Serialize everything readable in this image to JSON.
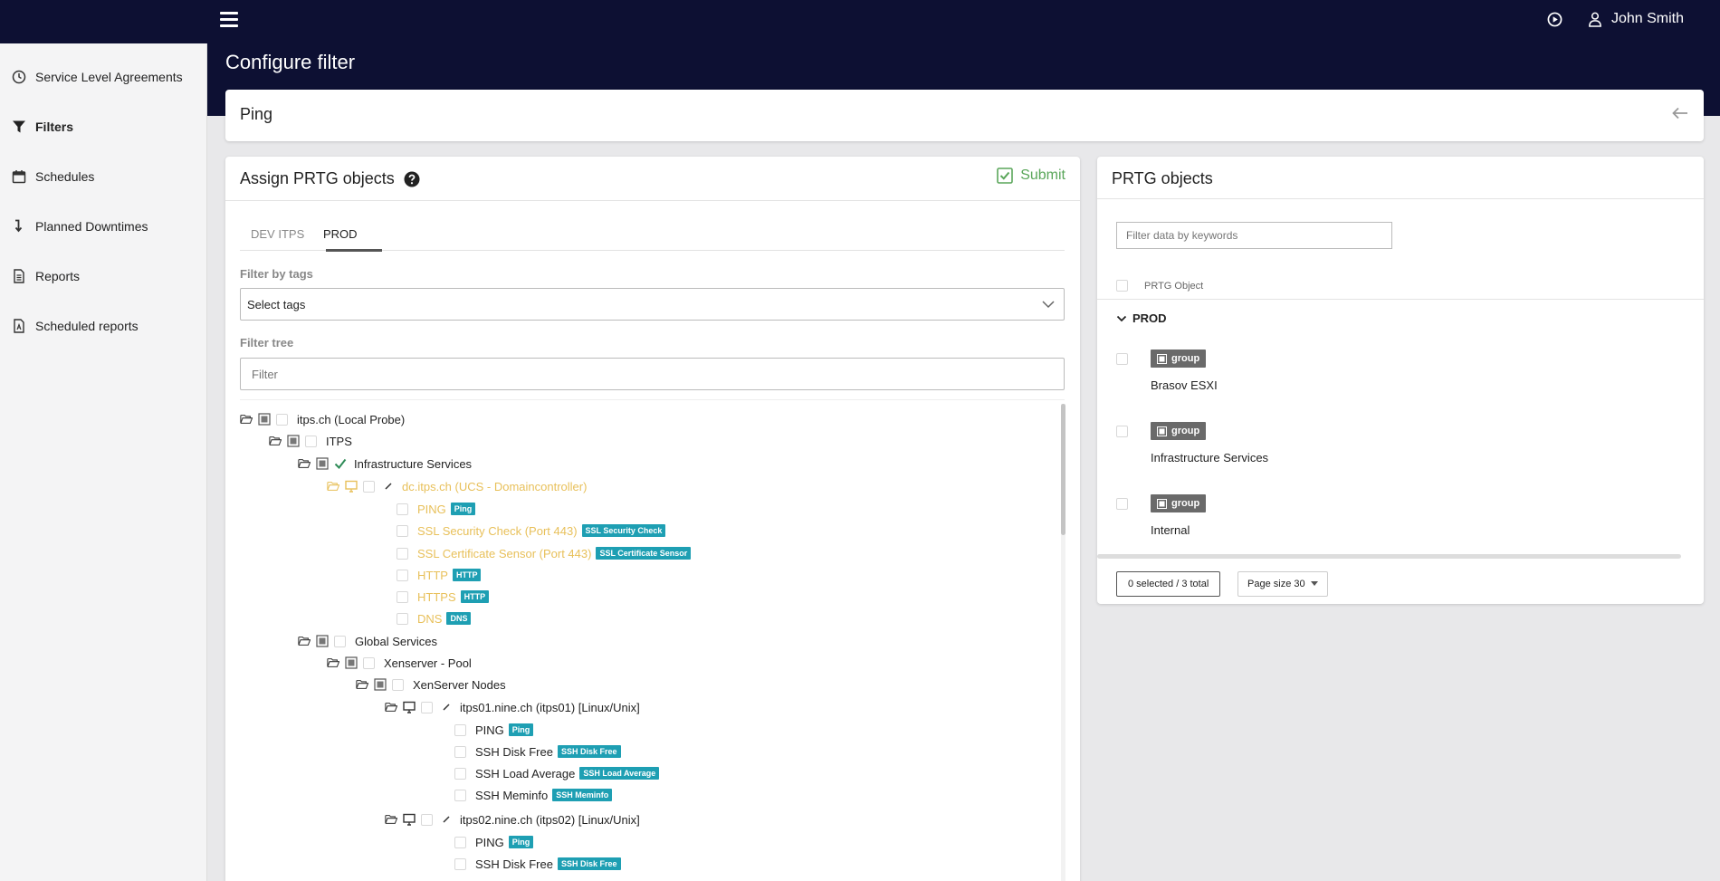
{
  "header": {
    "page_title": "Configure filter",
    "user_name": "John Smith"
  },
  "sidebar": {
    "items": [
      {
        "label": "Service Level Agreements",
        "icon": "clock-icon"
      },
      {
        "label": "Filters",
        "icon": "filter-icon",
        "active": true
      },
      {
        "label": "Schedules",
        "icon": "calendar-icon"
      },
      {
        "label": "Planned Downtimes",
        "icon": "arrow-down-icon"
      },
      {
        "label": "Reports",
        "icon": "document-icon"
      },
      {
        "label": "Scheduled reports",
        "icon": "pdf-document-icon"
      }
    ]
  },
  "filter_card": {
    "title": "Ping"
  },
  "assign": {
    "title": "Assign PRTG objects",
    "submit_label": "Submit",
    "tabs": [
      {
        "label": "DEV ITPS"
      },
      {
        "label": "PROD",
        "active": true
      }
    ],
    "filter_by_tags_label": "Filter by tags",
    "select_tags_placeholder": "Select tags",
    "filter_tree_label": "Filter tree",
    "filter_tree_placeholder": "Filter",
    "tree": [
      {
        "label": "itps.ch (Local Probe)",
        "type": "probe"
      },
      {
        "label": "ITPS",
        "type": "group"
      },
      {
        "label": "Infrastructure Services",
        "type": "group",
        "checked": true
      },
      {
        "label": "dc.itps.ch (UCS - Domaincontroller)",
        "type": "device"
      },
      {
        "label": "PING",
        "tag": "Ping"
      },
      {
        "label": "SSL Security Check (Port 443)",
        "tag": "SSL Security Check"
      },
      {
        "label": "SSL Certificate Sensor (Port 443)",
        "tag": "SSL Certificate Sensor"
      },
      {
        "label": "HTTP",
        "tag": "HTTP"
      },
      {
        "label": "HTTPS",
        "tag": "HTTP"
      },
      {
        "label": "DNS",
        "tag": "DNS"
      },
      {
        "label": "Global Services",
        "type": "group"
      },
      {
        "label": "Xenserver - Pool",
        "type": "group"
      },
      {
        "label": "XenServer Nodes",
        "type": "group"
      },
      {
        "label": "itps01.nine.ch (itps01) [Linux/Unix]",
        "type": "device"
      },
      {
        "label": "PING",
        "tag": "Ping"
      },
      {
        "label": "SSH Disk Free",
        "tag": "SSH Disk Free"
      },
      {
        "label": "SSH Load Average",
        "tag": "SSH Load Average"
      },
      {
        "label": "SSH Meminfo",
        "tag": "SSH Meminfo"
      },
      {
        "label": "itps02.nine.ch (itps02) [Linux/Unix]",
        "type": "device"
      },
      {
        "label": "PING",
        "tag": "Ping"
      },
      {
        "label": "SSH Disk Free",
        "tag": "SSH Disk Free"
      }
    ]
  },
  "prtg": {
    "title": "PRTG objects",
    "search_placeholder": "Filter data by keywords",
    "column_header": "PRTG Object",
    "group_name": "PROD",
    "badge_label": "group",
    "objects": [
      {
        "name": "Brasov ESXI"
      },
      {
        "name": "Infrastructure Services"
      },
      {
        "name": "Internal"
      }
    ],
    "selection_status": "0 selected / 3 total",
    "page_size_label": "Page size 30"
  },
  "colors": {
    "topbar": "#0d1033",
    "tag_badge": "#1e9fb3",
    "submit": "#5aa65a",
    "highlight": "#e8c05a"
  }
}
